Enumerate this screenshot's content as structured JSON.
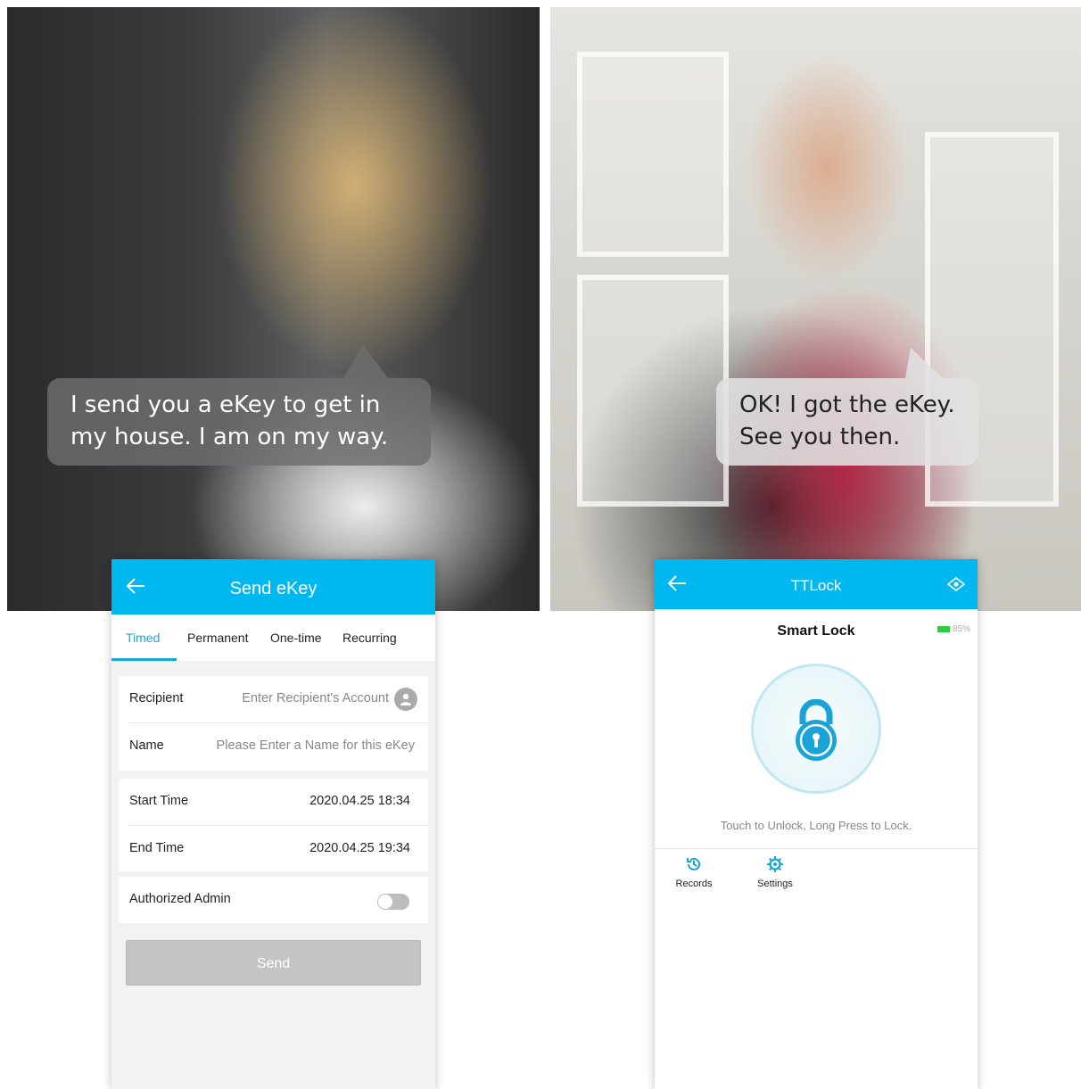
{
  "left_photo": {
    "speech": "I send you a eKey to get in my house. I am on my way."
  },
  "right_photo": {
    "speech": "OK! I got the eKey. See you then."
  },
  "send_ekey_screen": {
    "title": "Send eKey",
    "tabs": [
      "Timed",
      "Permanent",
      "One-time",
      "Recurring"
    ],
    "active_tab": "Timed",
    "recipient": {
      "label": "Recipient",
      "placeholder": "Enter Recipient's Account"
    },
    "name": {
      "label": "Name",
      "placeholder": "Please Enter a Name for this eKey"
    },
    "start_time": {
      "label": "Start Time",
      "value": "2020.04.25 18:34"
    },
    "end_time": {
      "label": "End Time",
      "value": "2020.04.25 19:34"
    },
    "authorized_admin": {
      "label": "Authorized Admin",
      "enabled": false
    },
    "send_label": "Send",
    "colors": {
      "accent": "#00b8f0",
      "tab_active": "#17a7d8"
    }
  },
  "ttlock_screen": {
    "title": "TTLock",
    "lock_name": "Smart Lock",
    "battery": "85%",
    "hint": "Touch to Unlock, Long Press to Lock.",
    "nav": [
      {
        "label": "Records",
        "icon": "history-icon"
      },
      {
        "label": "Settings",
        "icon": "gear-icon"
      }
    ]
  }
}
